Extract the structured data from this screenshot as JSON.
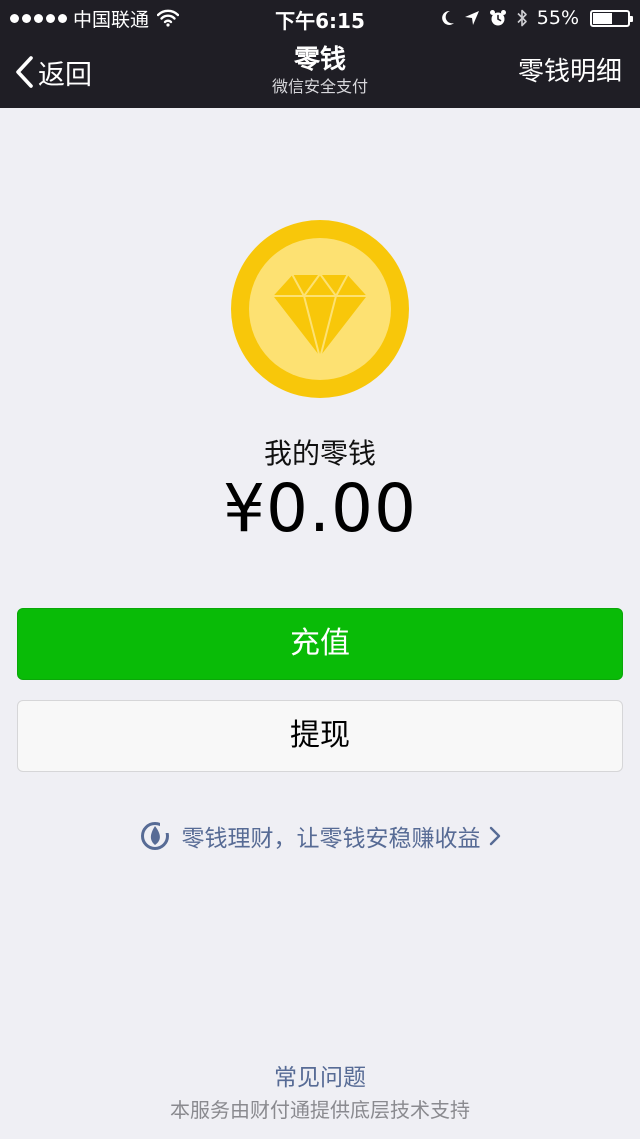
{
  "status_bar": {
    "carrier": "中国联通",
    "time": "下午6:15",
    "battery_text": "55%",
    "battery_level": 0.55
  },
  "nav": {
    "back_label": "返回",
    "title": "零钱",
    "subtitle": "微信安全支付",
    "right_label": "零钱明细"
  },
  "wallet": {
    "label": "我的零钱",
    "amount": "¥0.00"
  },
  "buttons": {
    "recharge": "充值",
    "withdraw": "提现"
  },
  "promo": {
    "text": "零钱理财，让零钱安稳赚收益",
    "icon": "licaitong-icon"
  },
  "footer": {
    "faq": "常见问题",
    "note": "本服务由财付通提供底层技术支持"
  },
  "colors": {
    "header_bg": "#1f1e25",
    "page_bg": "#efeff4",
    "primary_green": "#09bb07",
    "link_blue": "#576b95",
    "coin_outer": "#f8c70a",
    "coin_inner": "#fde172"
  }
}
